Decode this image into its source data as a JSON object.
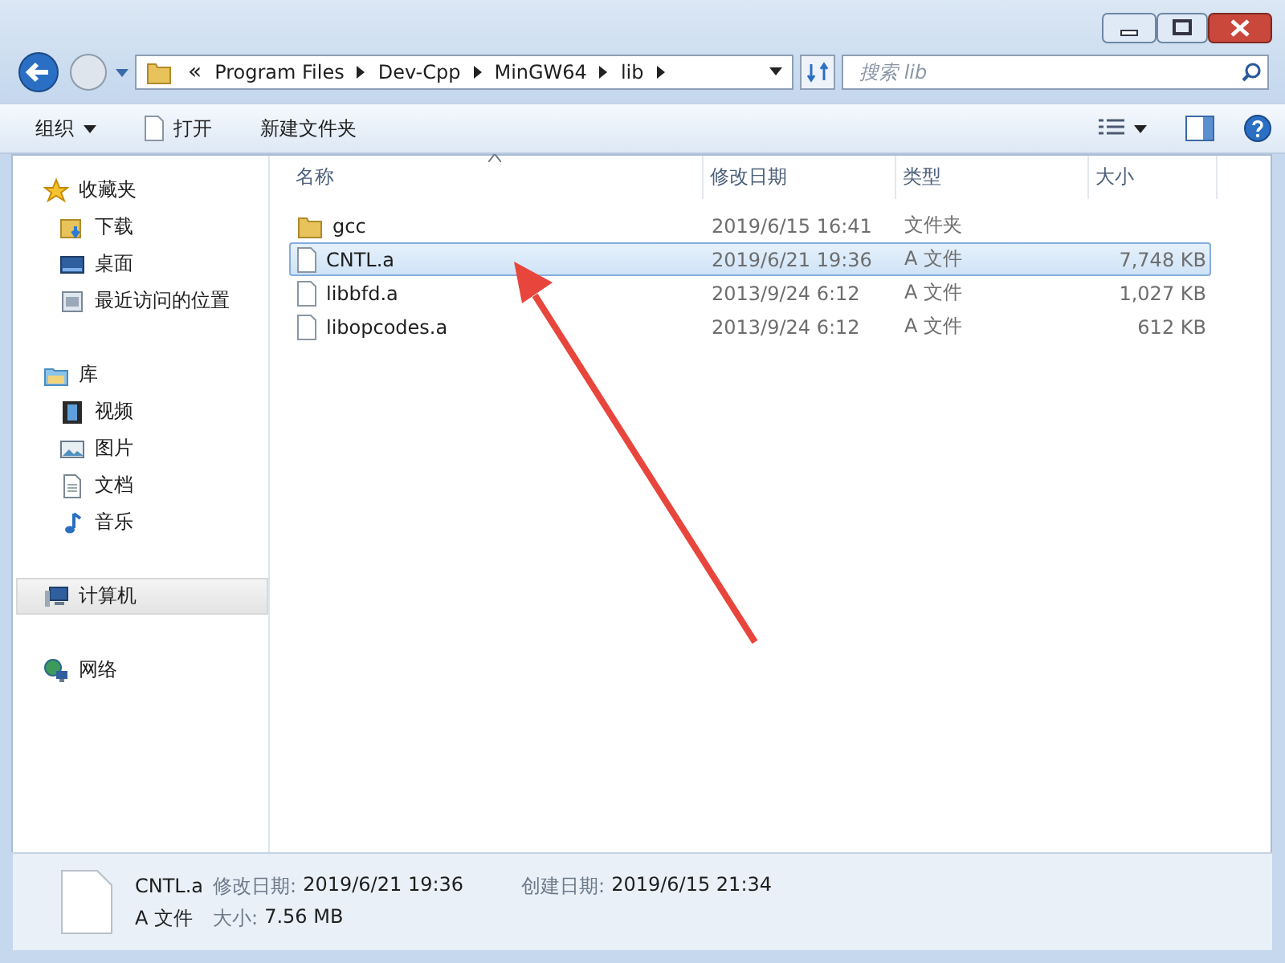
{
  "address": {
    "overflow": "«",
    "breadcrumbs": [
      "Program Files",
      "Dev-Cpp",
      "MinGW64",
      "lib"
    ]
  },
  "search": {
    "placeholder": "搜索 lib"
  },
  "toolbar": {
    "items": [
      {
        "label": "组织",
        "kind": "menu"
      },
      {
        "label": "打开",
        "kind": "open"
      },
      {
        "label": "新建文件夹",
        "kind": "plain"
      }
    ]
  },
  "sidebar": {
    "groups": [
      {
        "label": "收藏夹",
        "kind": "star",
        "selected": false,
        "children": [
          {
            "label": "下载",
            "kind": "download",
            "selected": false
          },
          {
            "label": "桌面",
            "kind": "desktop",
            "selected": false
          },
          {
            "label": "最近访问的位置",
            "kind": "recent",
            "selected": false
          }
        ]
      },
      {
        "label": "库",
        "kind": "library",
        "selected": false,
        "children": [
          {
            "label": "视频",
            "kind": "video",
            "selected": false
          },
          {
            "label": "图片",
            "kind": "picture",
            "selected": false
          },
          {
            "label": "文档",
            "kind": "document",
            "selected": false
          },
          {
            "label": "音乐",
            "kind": "music",
            "selected": false
          }
        ]
      },
      {
        "label": "计算机",
        "kind": "computer",
        "selected": true
      },
      {
        "label": "网络",
        "kind": "network",
        "selected": false
      }
    ]
  },
  "table": {
    "columns": [
      {
        "label": "名称",
        "sorted": true
      },
      {
        "label": "修改日期",
        "sorted": false
      },
      {
        "label": "类型",
        "sorted": false
      },
      {
        "label": "大小",
        "sorted": false
      }
    ],
    "rows": [
      {
        "name": "gcc",
        "kind": "folder",
        "modified": "2019/6/15 16:41",
        "type": "文件夹",
        "selected": false
      },
      {
        "name": "CNTL.a",
        "kind": "file",
        "modified": "2019/6/21 19:36",
        "type": "A 文件",
        "size": "7,748 KB",
        "selected": true
      },
      {
        "name": "libbfd.a",
        "kind": "file",
        "modified": "2013/9/24 6:12",
        "type": "A 文件",
        "size": "1,027 KB",
        "selected": false
      },
      {
        "name": "libopcodes.a",
        "kind": "file",
        "modified": "2013/9/24 6:12",
        "type": "A 文件",
        "size": "612 KB",
        "selected": false
      }
    ]
  },
  "annotations": [
    {
      "kind": "arrow"
    }
  ],
  "details": {
    "name": "CNTL.a",
    "type": "A 文件",
    "fields": [
      {
        "label": "修改日期:",
        "value": "2019/6/21 19:36"
      },
      {
        "label": "创建日期:",
        "value": "2019/6/15 21:34"
      },
      {
        "label": "大小:",
        "value": "7.56 MB"
      }
    ]
  }
}
